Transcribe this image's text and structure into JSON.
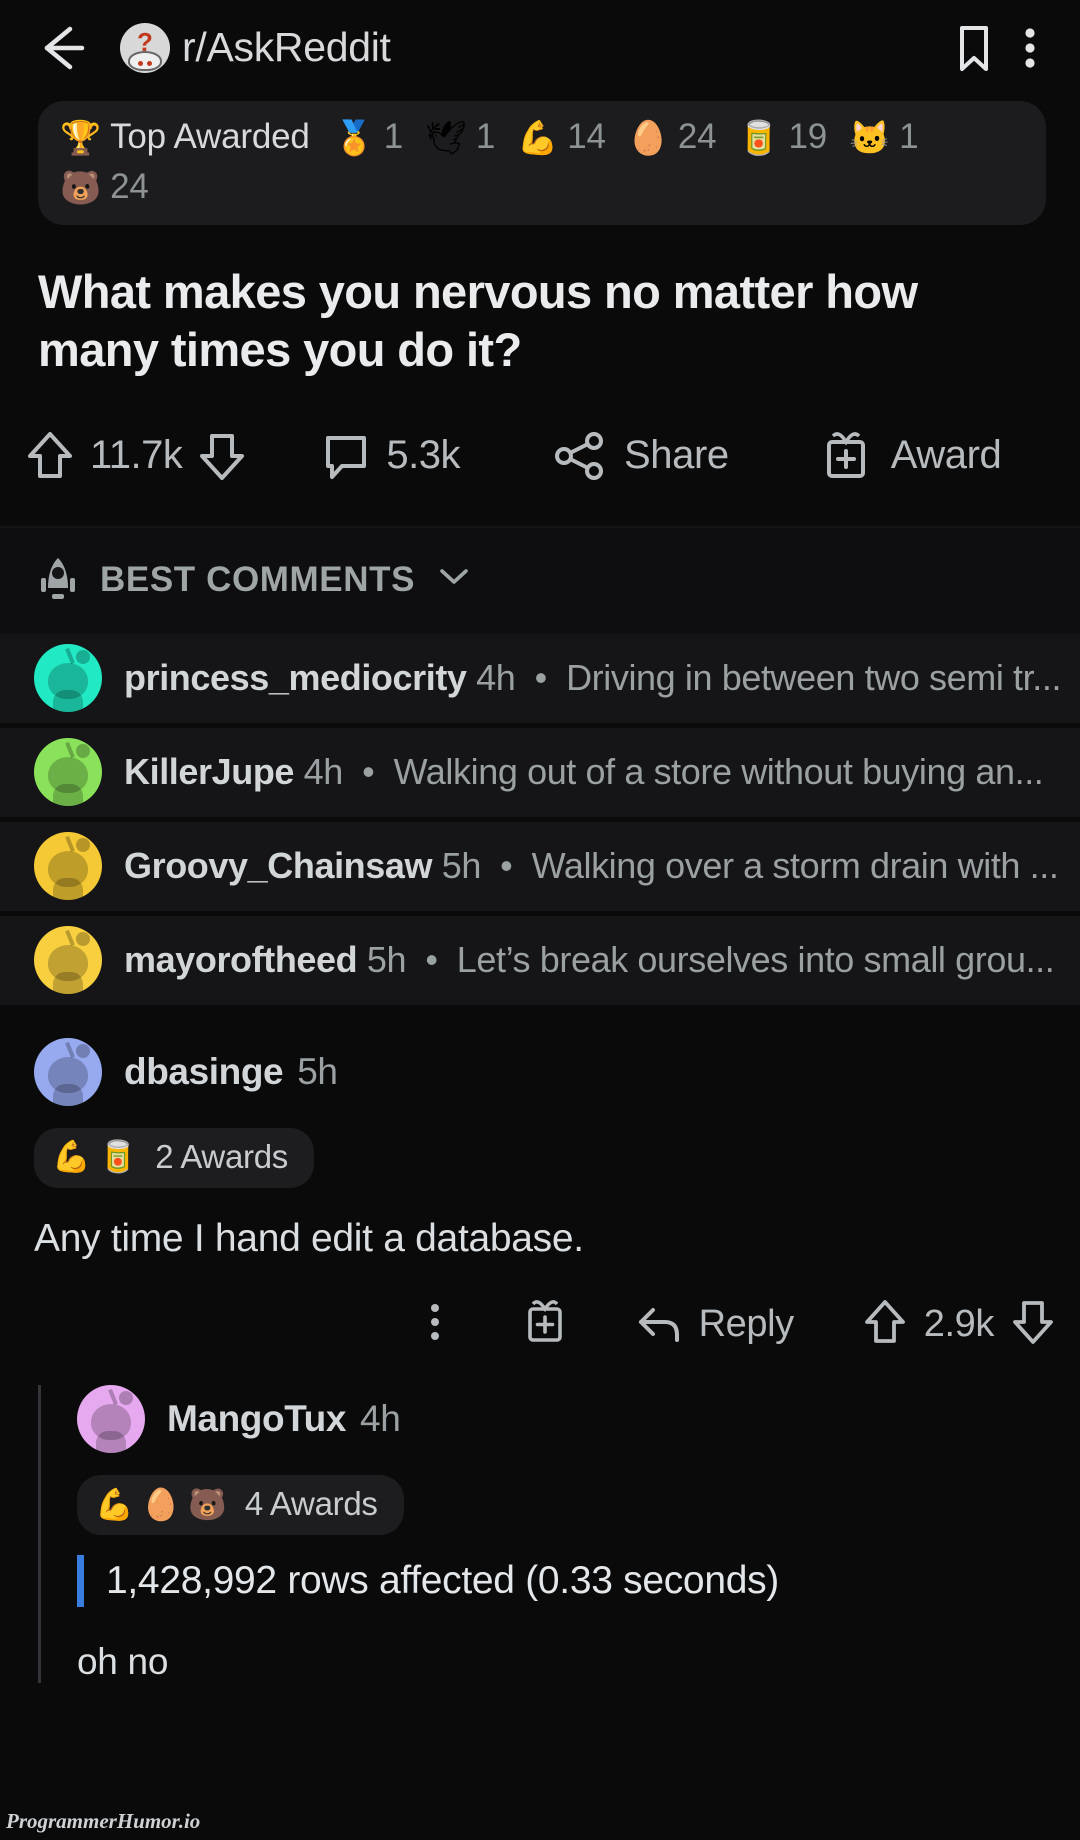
{
  "topbar": {
    "back_icon": "back-arrow-icon",
    "subreddit": "r/AskReddit",
    "bookmark_icon": "bookmark-icon",
    "overflow_icon": "kebab-menu-icon"
  },
  "top_awarded": {
    "trophy_emoji": "🏆",
    "label": "Top Awarded",
    "awards": [
      {
        "emoji": "🏅",
        "count": "1"
      },
      {
        "emoji": "🕊",
        "count": "1"
      },
      {
        "emoji": "💪",
        "count": "14"
      },
      {
        "emoji": "🥚",
        "count": "24"
      },
      {
        "emoji": "🥫",
        "count": "19"
      },
      {
        "emoji": "🐱",
        "count": "1"
      }
    ],
    "wrapped": {
      "emoji": "🐻",
      "count": "24"
    }
  },
  "post": {
    "title": "What makes you nervous no matter how many times you do it?",
    "upvotes": "11.7k",
    "comments": "5.3k",
    "share_label": "Share",
    "award_label": "Award"
  },
  "sort": {
    "icon": "rocket-icon",
    "label": "BEST COMMENTS",
    "chevron": "chevron-down-icon"
  },
  "preview_comments": [
    {
      "user": "princess_mediocrity",
      "time": "4h",
      "body": "Driving in between two semi tr...",
      "avatar_color": "#21e9c4"
    },
    {
      "user": "KillerJupe",
      "time": "4h",
      "body": "Walking out of a store without buying an...",
      "avatar_color": "#8ae25b"
    },
    {
      "user": "Groovy_Chainsaw",
      "time": "5h",
      "body": "Walking over a storm drain with ...",
      "avatar_color": "#f5c935"
    },
    {
      "user": "mayoroftheed",
      "time": "5h",
      "body": "Let’s break ourselves into small grou...",
      "avatar_color": "#f7cf3f"
    }
  ],
  "comment": {
    "user": "dbasinge",
    "time": "5h",
    "avatar_color": "#97aaf0",
    "awards_emojis": [
      "💪",
      "🥫"
    ],
    "awards_label": "2 Awards",
    "body": "Any time I hand edit a database.",
    "overflow_icon": "kebab-menu-icon",
    "award_icon": "award-gift-icon",
    "reply_icon": "reply-arrow-icon",
    "reply_label": "Reply",
    "score": "2.9k"
  },
  "reply": {
    "user": "MangoTux",
    "time": "4h",
    "avatar_color": "#e6a8ef",
    "awards_emojis": [
      "💪",
      "🥚",
      "🐻"
    ],
    "awards_label": "4 Awards",
    "quote": "1,428,992 rows affected (0.33 seconds)",
    "text": "oh no",
    "quote_color": "#3a7de0"
  },
  "footer": {
    "watermark": "ProgrammerHumor.io"
  }
}
